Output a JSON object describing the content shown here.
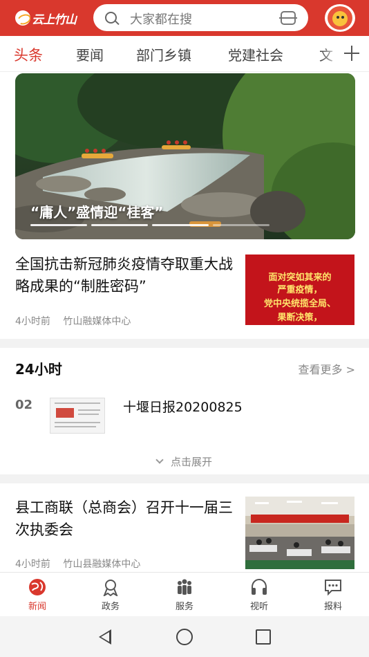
{
  "app": {
    "logo_text": "云上竹山"
  },
  "search": {
    "placeholder": "大家都在搜"
  },
  "tabs": [
    {
      "label": "头条",
      "active": true
    },
    {
      "label": "要闻"
    },
    {
      "label": "部门乡镇"
    },
    {
      "label": "党建社会"
    },
    {
      "label": "文"
    }
  ],
  "banner": {
    "caption": "“庸人”盛情迎“桂客”",
    "slide_count": 4,
    "active_slide": 1
  },
  "news1": {
    "title": "全国抗击新冠肺炎疫情夺取重大战略成果的“制胜密码”",
    "time": "4小时前",
    "source": "竹山融媒体中心",
    "thumb_lines": [
      "面对突如其来的",
      "严重疫情，",
      "党中央统揽全局、",
      "果断决策，"
    ]
  },
  "hot24": {
    "title": "24小时",
    "more": "查看更多 >",
    "items": [
      {
        "rank": "02",
        "title": "十堰日报20200825"
      }
    ],
    "expand": "点击展开"
  },
  "news2": {
    "title": "县工商联（总商会）召开十一届三次执委会",
    "time": "4小时前",
    "source": "竹山县融媒体中心"
  },
  "bottom_nav": [
    {
      "label": "新闻",
      "icon": "globe-icon",
      "active": true
    },
    {
      "label": "政务",
      "icon": "badge-icon"
    },
    {
      "label": "服务",
      "icon": "people-icon"
    },
    {
      "label": "视听",
      "icon": "headphones-icon"
    },
    {
      "label": "报料",
      "icon": "chat-icon"
    }
  ],
  "colors": {
    "brand": "#d9382d",
    "thumb_red": "#c3141b",
    "thumb_text": "#ffe56b"
  }
}
